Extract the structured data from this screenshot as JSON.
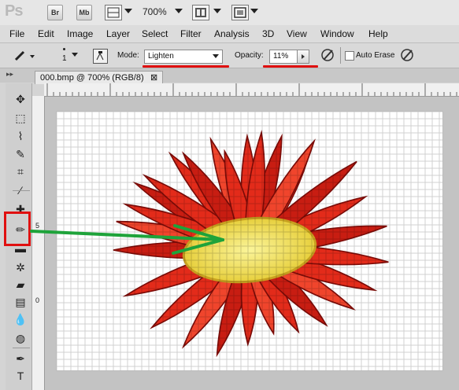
{
  "app": {
    "logo": "Ps",
    "bridge_label": "Br",
    "minibridge_label": "Mb",
    "zoom": "700%"
  },
  "menu": [
    "File",
    "Edit",
    "Image",
    "Layer",
    "Select",
    "Filter",
    "Analysis",
    "3D",
    "View",
    "Window",
    "Help"
  ],
  "options": {
    "brush_size": "1",
    "mode_label": "Mode:",
    "mode_value": "Lighten",
    "opacity_label": "Opacity:",
    "opacity_value": "11%",
    "auto_erase_label": "Auto Erase",
    "auto_erase_checked": false
  },
  "document": {
    "tab_title": "000.bmp @ 700% (RGB/8)",
    "close_glyph": "⊠"
  },
  "rulers": {
    "left_marks": [
      "5",
      "0"
    ]
  },
  "tools": [
    {
      "name": "move-tool-icon",
      "glyph": "✥"
    },
    {
      "name": "marquee-tool-icon",
      "glyph": "⬚"
    },
    {
      "name": "lasso-tool-icon",
      "glyph": "⌇"
    },
    {
      "name": "quick-select-tool-icon",
      "glyph": "✎"
    },
    {
      "name": "crop-tool-icon",
      "glyph": "⌗"
    },
    {
      "name": "eyedropper-tool-icon",
      "glyph": "⁄"
    },
    {
      "name": "healing-brush-tool-icon",
      "glyph": "✚"
    },
    {
      "name": "pencil-tool-icon",
      "glyph": "✏"
    },
    {
      "name": "clone-stamp-tool-icon",
      "glyph": "▬"
    },
    {
      "name": "history-brush-tool-icon",
      "glyph": "✲"
    },
    {
      "name": "eraser-tool-icon",
      "glyph": "▰"
    },
    {
      "name": "gradient-tool-icon",
      "glyph": "▤"
    },
    {
      "name": "blur-tool-icon",
      "glyph": "💧"
    },
    {
      "name": "dodge-tool-icon",
      "glyph": "◍"
    },
    {
      "name": "pen-tool-icon",
      "glyph": "✒"
    },
    {
      "name": "type-tool-icon",
      "glyph": "T"
    }
  ],
  "colors": {
    "annotation_red": "#e01010",
    "annotation_green": "#1ea33a",
    "flower_red": "#e32b1a",
    "flower_center": "#f5ef6a"
  }
}
